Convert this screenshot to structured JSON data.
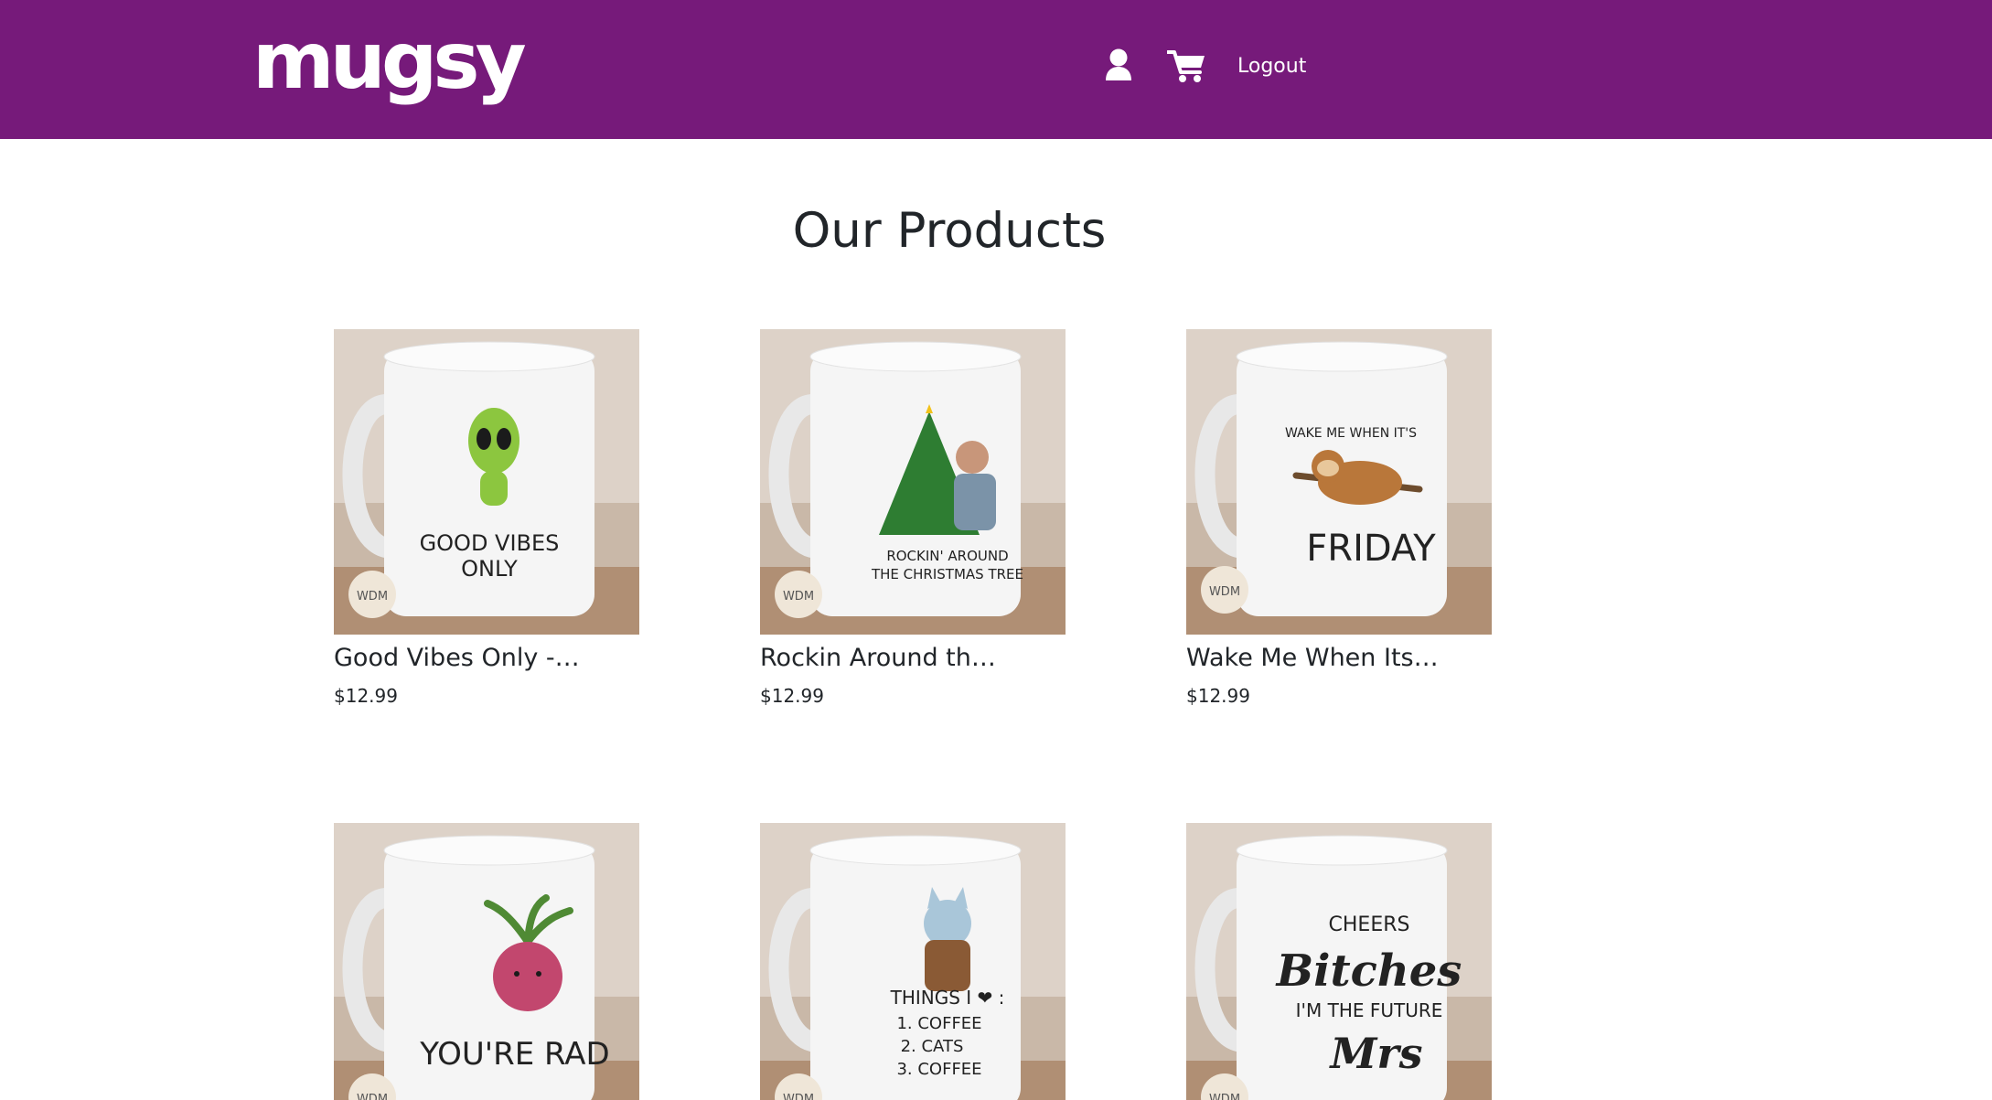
{
  "header": {
    "brand": "mugsy",
    "logout_label": "Logout",
    "icons": [
      "user-icon",
      "shopping-cart-icon"
    ],
    "background_color": "#761a7a"
  },
  "main": {
    "title": "Our Products"
  },
  "products": [
    {
      "title": "Good Vibes Only -…",
      "price": "$12.99",
      "design_text": "GOOD VIBES ONLY"
    },
    {
      "title": "Rockin Around th…",
      "price": "$12.99",
      "design_text": "ROCKIN' AROUND THE CHRISTMAS TREE"
    },
    {
      "title": "Wake Me When Its…",
      "price": "$12.99",
      "design_text": "WAKE ME WHEN IT'S FRIDAY"
    },
    {
      "design_text": "YOU'RE RAD (ISH)"
    },
    {
      "design_text": "THINGS I ❤ : 1. COFFEE 2. CATS 3. COFFEE"
    },
    {
      "design_text": "CHEERS Bitches I'M THE FUTURE Mrs"
    }
  ],
  "badge_text": "WDM"
}
